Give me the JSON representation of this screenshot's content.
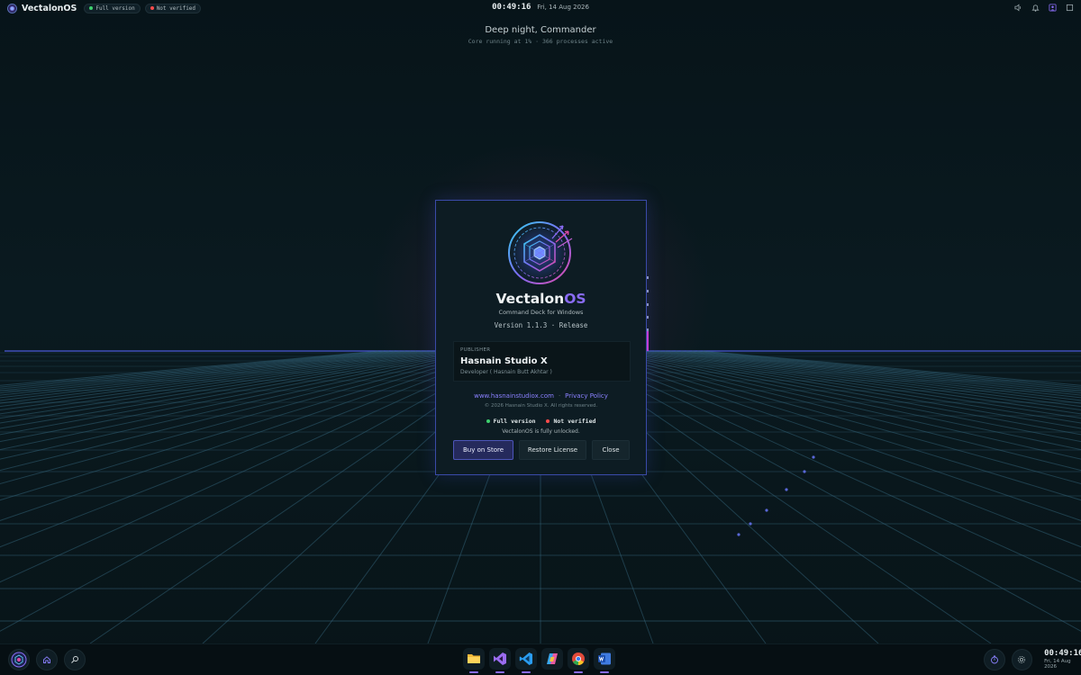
{
  "topbar": {
    "brand": "Vectalon",
    "brand_suffix": "OS",
    "pill_full": "Full version",
    "pill_notverified": "Not verified",
    "time": "00:49:16",
    "date": "Fri, 14 Aug 2026",
    "icons": [
      "volume-icon",
      "bell-icon",
      "user-frame-icon",
      "window-icon"
    ]
  },
  "greeting": {
    "title": "Deep night, Commander",
    "subtitle": "Core running at 1% · 366 processes active"
  },
  "about": {
    "name": "Vectalon",
    "name_suffix": "OS",
    "tagline": "Command Deck for Windows",
    "version": "Version 1.1.3  · Release",
    "publisher_label": "PUBLISHER",
    "publisher_name": "Hasnain Studio X",
    "publisher_dev": "Developer ( Hasnain Butt Akhtar )",
    "website": "www.hasnainstudiox.com",
    "link_sep": "·",
    "privacy": "Privacy Policy",
    "copyright": "© 2026 Hasnain Studio X. All rights reserved.",
    "status_full": "Full version",
    "status_notverified": "Not verified",
    "unlock_msg": "VectalonOS is fully unlocked.",
    "buttons": {
      "buy": "Buy on Store",
      "restore": "Restore License",
      "close": "Close"
    }
  },
  "taskbar": {
    "apps": [
      "file-explorer",
      "visual-studio",
      "vs-code",
      "copilot",
      "chrome",
      "word"
    ],
    "time": "00:49:16",
    "date": "Fri, 14 Aug 2026"
  },
  "colors": {
    "accent": "#8a6cf5",
    "border": "#3a4aa8",
    "green": "#3ed06e",
    "red": "#ff4b4b"
  }
}
